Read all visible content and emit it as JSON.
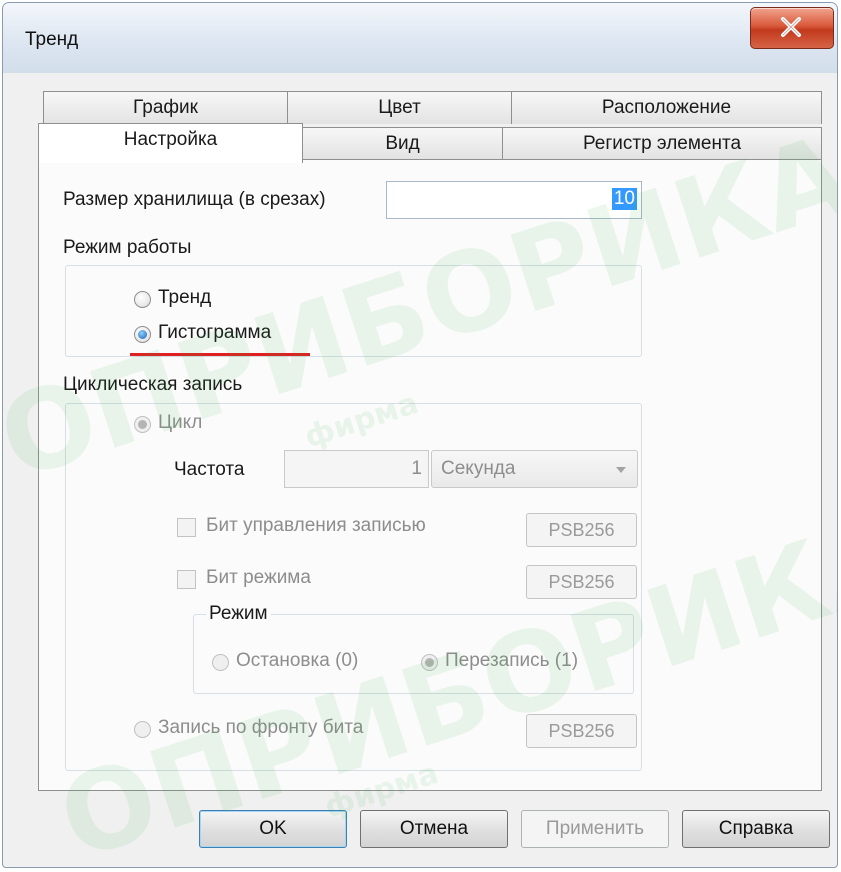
{
  "window": {
    "title": "Тренд",
    "close_icon": "close-x-icon"
  },
  "tabs": {
    "row_back": [
      "График",
      "Цвет",
      "Расположение"
    ],
    "row_front": [
      "Настройка",
      "Вид",
      "Регистр элемента"
    ],
    "active": "Настройка"
  },
  "storage": {
    "label": "Размер хранилища (в срезах)",
    "value": "10"
  },
  "mode": {
    "label": "Режим работы",
    "options": [
      "Тренд",
      "Гистограмма"
    ],
    "selected": "Гистограмма"
  },
  "cyclic": {
    "label": "Циклическая запись",
    "cycle_label": "Цикл",
    "frequency_label": "Частота",
    "frequency_value": "1",
    "unit_value": "Секунда",
    "record_control_bit_label": "Бит управления записью",
    "record_control_bit_button": "PSB256",
    "mode_bit_label": "Бит режима",
    "mode_bit_button": "PSB256",
    "mode_group_label": "Режим",
    "stop_label": "Остановка (0)",
    "overwrite_label": "Перезапись (1)",
    "edge_record_label": "Запись по фронту бита",
    "edge_record_button": "PSB256"
  },
  "buttons": {
    "ok": "OK",
    "cancel": "Отмена",
    "apply": "Применить",
    "help": "Справка"
  },
  "watermark": {
    "brand": "ОПРИБОРИКА",
    "small": "фирма"
  },
  "colors": {
    "highlight_underline": "#e02020",
    "selection": "#3399ff",
    "close_button": "#c94a2e"
  }
}
